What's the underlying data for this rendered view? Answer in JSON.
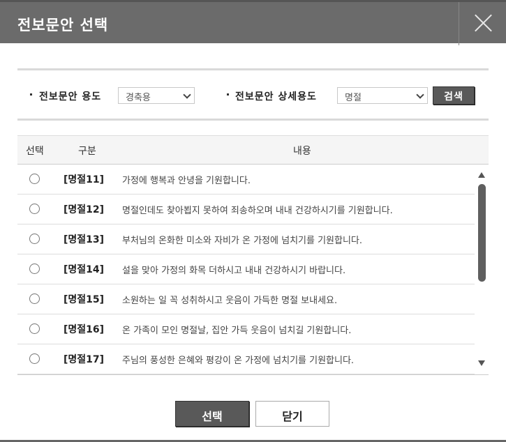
{
  "dialog": {
    "title": "전보문안 선택"
  },
  "search": {
    "purpose_label": "전보문안 용도",
    "purpose_value": "경축용",
    "detail_label": "전보문안 상세용도",
    "detail_value": "명절",
    "search_button": "검색"
  },
  "table": {
    "headers": {
      "select": "선택",
      "category": "구분",
      "content": "내용"
    },
    "rows": [
      {
        "category": "[명절11]",
        "content": "가정에 행복과 안녕을 기원합니다."
      },
      {
        "category": "[명절12]",
        "content": "명절인데도 찾아뵙지 못하여 죄송하오며 내내 건강하시기를 기원합니다."
      },
      {
        "category": "[명절13]",
        "content": "부처님의 온화한 미소와 자비가 온 가정에 넘치기를 기원합니다."
      },
      {
        "category": "[명절14]",
        "content": "설을 맞아 가정의 화목 더하시고 내내 건강하시기 바랍니다."
      },
      {
        "category": "[명절15]",
        "content": "소원하는 일 꼭 성취하시고 웃음이 가득한 명절 보내세요."
      },
      {
        "category": "[명절16]",
        "content": "온 가족이 모인 명절날, 집안 가득 웃음이 넘치길 기원합니다."
      },
      {
        "category": "[명절17]",
        "content": "주님의 풍성한 은혜와 평강이 온 가정에 넘치기를 기원합니다."
      }
    ]
  },
  "footer": {
    "select_button": "선택",
    "close_button": "닫기"
  },
  "colors": {
    "titlebar": "#6b6b6b",
    "dark_button": "#595959",
    "header_bg": "#f5f5f5"
  }
}
